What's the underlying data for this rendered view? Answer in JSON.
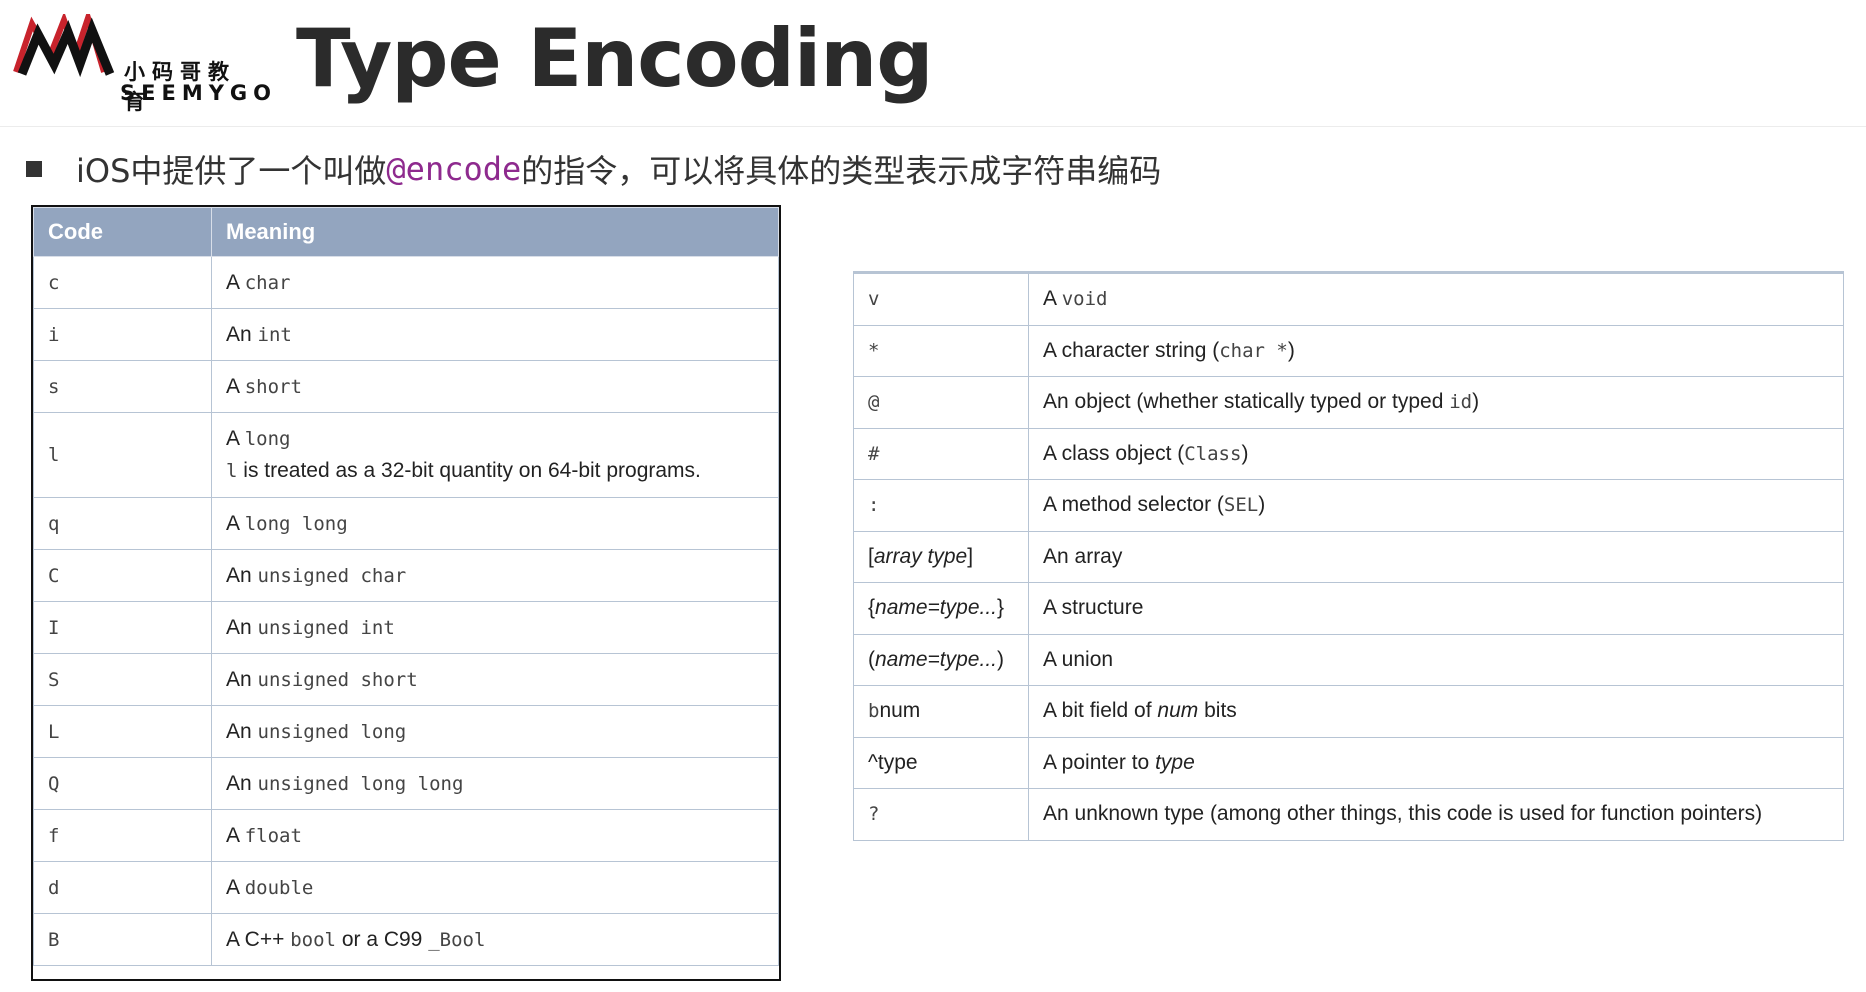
{
  "logo": {
    "chinese": "小码哥教育",
    "english": "SEEMYGO"
  },
  "title": "Type Encoding",
  "bullet": {
    "before": "iOS中提供了一个叫做",
    "code": "@encode",
    "after": "的指令，可以将具体的类型表示成字符串编码"
  },
  "left_table": {
    "headers": {
      "code": "Code",
      "meaning": "Meaning"
    },
    "rows": [
      {
        "code": "c",
        "prefix": "A ",
        "mono": "char"
      },
      {
        "code": "i",
        "prefix": "An ",
        "mono": "int"
      },
      {
        "code": "s",
        "prefix": "A ",
        "mono": "short"
      },
      {
        "code": "l",
        "prefix": "A ",
        "mono": "long",
        "note_mono": "l",
        "note_text": " is treated as a 32-bit quantity on 64-bit programs."
      },
      {
        "code": "q",
        "prefix": "A ",
        "mono": "long long"
      },
      {
        "code": "C",
        "prefix": "An ",
        "mono": "unsigned char"
      },
      {
        "code": "I",
        "prefix": "An ",
        "mono": "unsigned int"
      },
      {
        "code": "S",
        "prefix": "An ",
        "mono": "unsigned short"
      },
      {
        "code": "L",
        "prefix": "An ",
        "mono": "unsigned long"
      },
      {
        "code": "Q",
        "prefix": "An ",
        "mono": "unsigned long long"
      },
      {
        "code": "f",
        "prefix": "A ",
        "mono": "float"
      },
      {
        "code": "d",
        "prefix": "A ",
        "mono": "double"
      },
      {
        "code": "B",
        "prefix": "A C++ ",
        "mono": "bool",
        "middle": " or a C99 ",
        "mono2": "_Bool"
      }
    ]
  },
  "right_table": {
    "rows": [
      {
        "code": "v",
        "prefix": "A ",
        "mono": "void"
      },
      {
        "code": "*",
        "prefix": "A character string (",
        "mono": "char *",
        "suffix": ")"
      },
      {
        "code": "@",
        "prefix": "An object (whether statically typed or typed ",
        "mono": "id",
        "suffix": ")"
      },
      {
        "code": "#",
        "prefix": "A class object (",
        "mono": "Class",
        "suffix": ")"
      },
      {
        "code": ":",
        "prefix": "A method selector (",
        "mono": "SEL",
        "suffix": ")"
      },
      {
        "code_open": "[",
        "code_italic": "array type",
        "code_close": "]",
        "prefix": "An array"
      },
      {
        "code_open": "{",
        "code_italic": "name=type...",
        "code_close": "}",
        "prefix": "A structure"
      },
      {
        "code_open": "(",
        "code_italic": "name=type...",
        "code_close": ")",
        "prefix": "A union"
      },
      {
        "code_open": "b",
        "code_italic": "",
        "code_close": "num",
        "prefix": "A bit field of ",
        "italic": "num",
        "suffix": " bits"
      },
      {
        "code_open": "^type",
        "code_italic": "",
        "code_close": "",
        "prefix": "A pointer to ",
        "italic": "type"
      },
      {
        "code": "?",
        "prefix": "An unknown type (among other things, this code is used for function pointers)"
      }
    ]
  }
}
